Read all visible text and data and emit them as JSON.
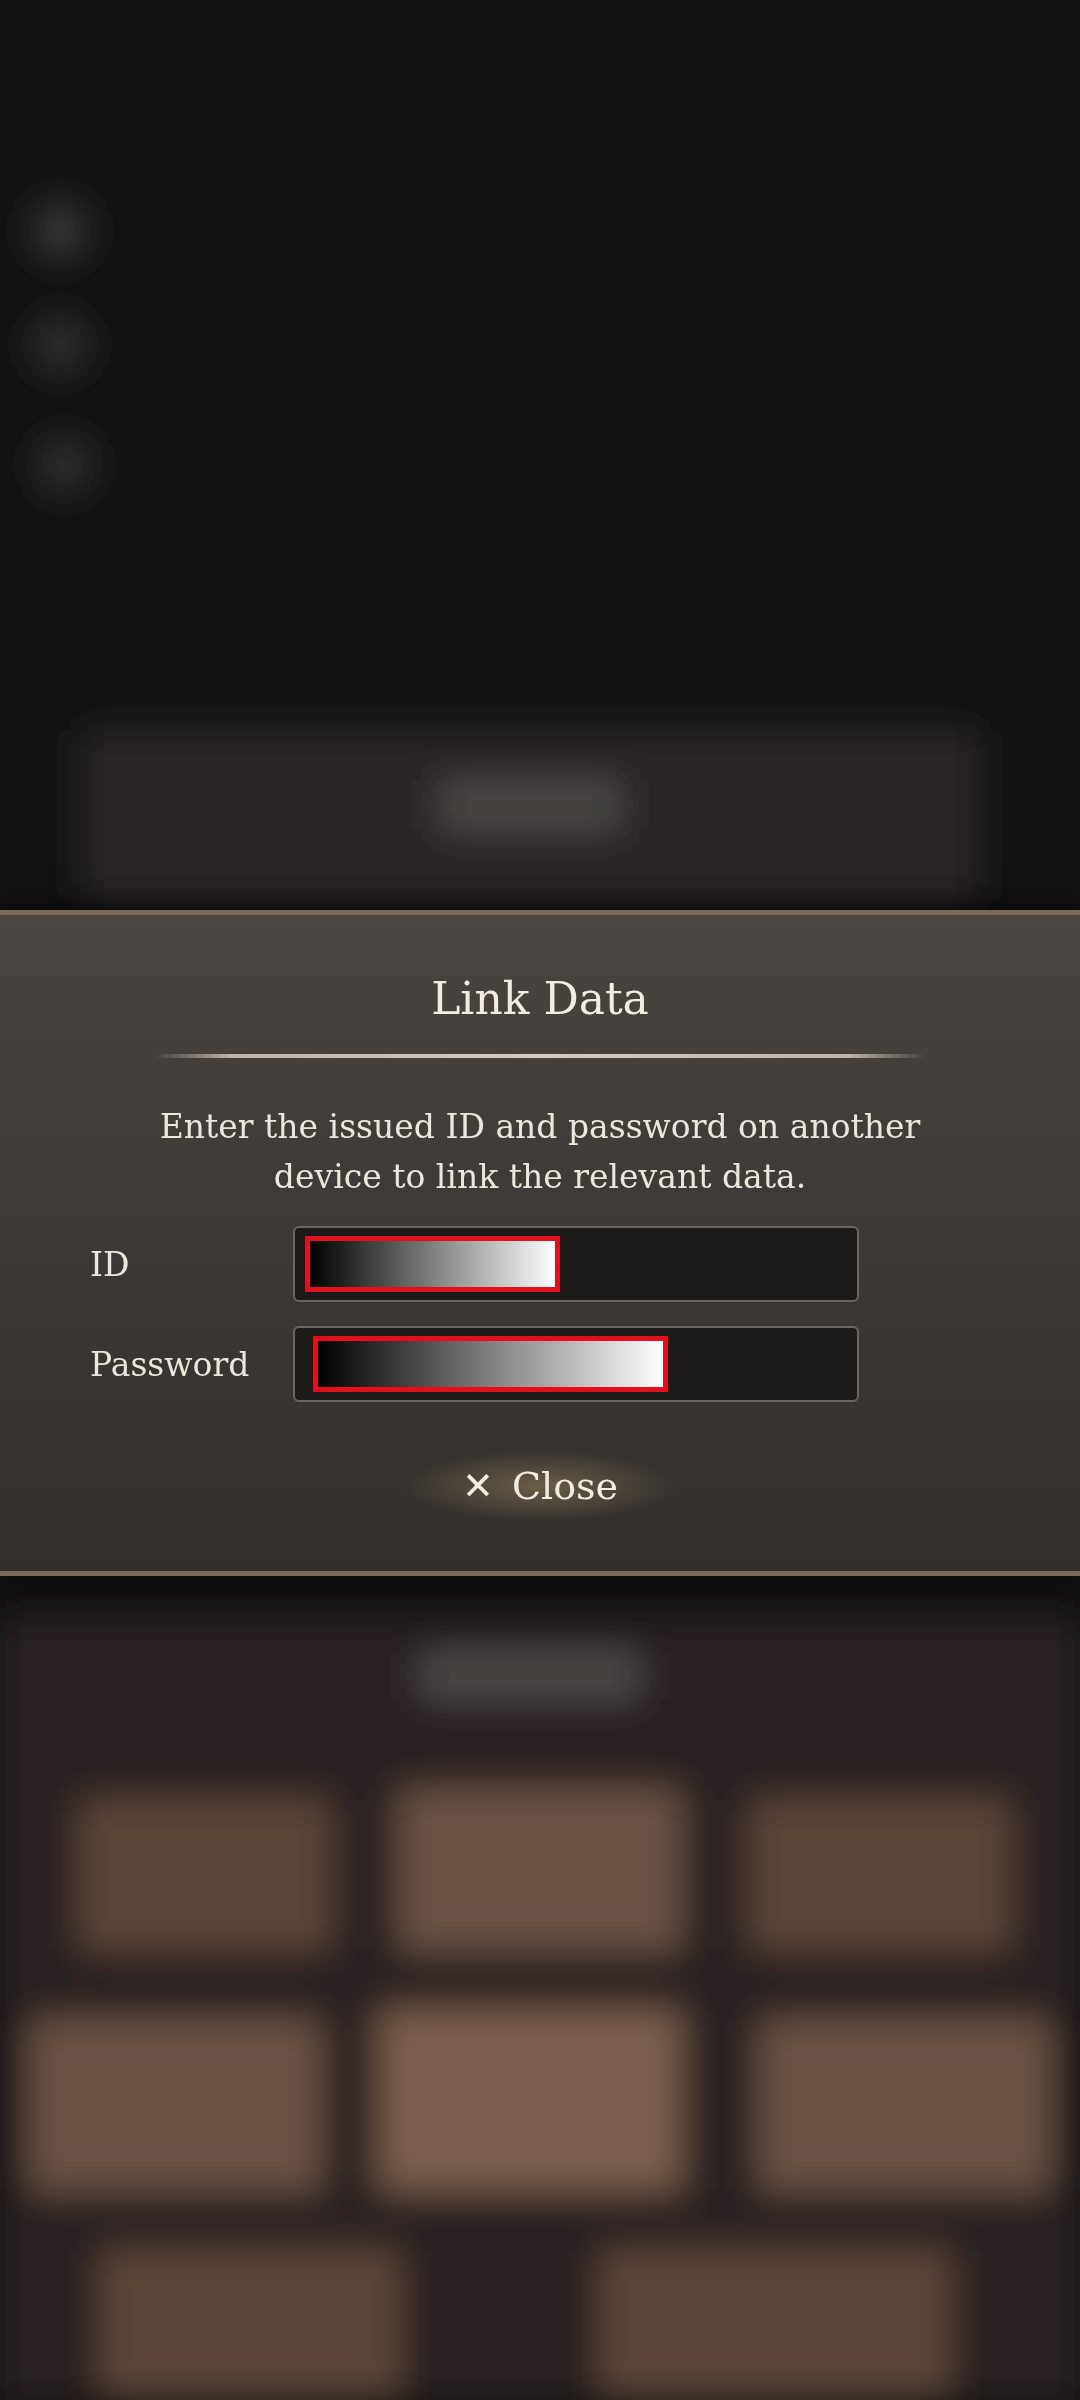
{
  "dialog": {
    "title": "Link Data",
    "message": "Enter the issued ID and password on another device to link the relevant data.",
    "fields": [
      {
        "label": "ID"
      },
      {
        "label": "Password"
      }
    ],
    "close_button": {
      "icon": "✕",
      "label": "Close"
    }
  }
}
